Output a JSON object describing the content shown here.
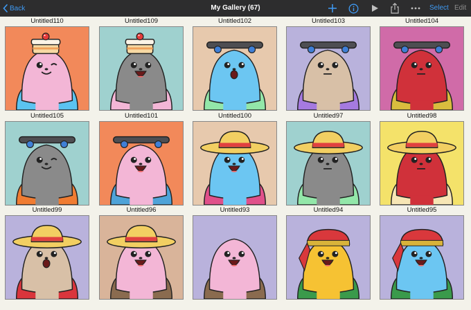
{
  "nav": {
    "back_label": "Back",
    "title": "My Gallery (67)",
    "select_label": "Select",
    "edit_label": "Edit",
    "accent": "#3f9bf5",
    "icons": [
      "plus-icon",
      "info-icon",
      "play-icon",
      "share-icon",
      "more-icon"
    ]
  },
  "gallery": {
    "items": [
      {
        "title": "Untitled110",
        "bg": "#f2895a",
        "body": "#f3b6d6",
        "shirt": "#5bc3f1",
        "hat": "cake",
        "face": "wink"
      },
      {
        "title": "Untitled109",
        "bg": "#9fd1cf",
        "body": "#8a8a8a",
        "shirt": "#f3b6d6",
        "hat": "cake",
        "face": "open"
      },
      {
        "title": "Untitled102",
        "bg": "#e7c9ad",
        "body": "#6cc6f2",
        "shirt": "#93e7a9",
        "hat": "skate",
        "face": "o"
      },
      {
        "title": "Untitled103",
        "bg": "#b9b2dc",
        "body": "#d8c0a7",
        "shirt": "#a57ae0",
        "hat": "skate",
        "face": "flat"
      },
      {
        "title": "Untitled104",
        "bg": "#d06ba8",
        "body": "#d0313a",
        "shirt": "#d9bd3e",
        "hat": "skate",
        "face": "flat"
      },
      {
        "title": "Untitled105",
        "bg": "#9fd1cf",
        "body": "#8a8a8a",
        "shirt": "#f07c32",
        "hat": "skate",
        "face": "wink"
      },
      {
        "title": "Untitled101",
        "bg": "#f2895a",
        "body": "#f3b6d6",
        "shirt": "#4fa3d8",
        "hat": "skate",
        "face": "open"
      },
      {
        "title": "Untitled100",
        "bg": "#e7c9ad",
        "body": "#6cc6f2",
        "shirt": "#e0508a",
        "hat": "straw",
        "face": "open"
      },
      {
        "title": "Untitled97",
        "bg": "#9fd1cf",
        "body": "#8a8a8a",
        "shirt": "#93e7a9",
        "hat": "straw",
        "face": "flat"
      },
      {
        "title": "Untitled98",
        "bg": "#f4e26a",
        "body": "#d0313a",
        "shirt": "#f7e6b5",
        "hat": "straw",
        "face": "flat"
      },
      {
        "title": "Untitled99",
        "bg": "#b9b2dc",
        "body": "#d8c0a7",
        "shirt": "#d9353c",
        "hat": "straw",
        "face": "o"
      },
      {
        "title": "Untitled96",
        "bg": "#d9b49a",
        "body": "#f3b6d6",
        "shirt": "#8a6b4f",
        "hat": "straw",
        "face": "open"
      },
      {
        "title": "Untitled93",
        "bg": "#b9b2dc",
        "body": "#f3b6d6",
        "shirt": "#8a6b4f",
        "hat": "none",
        "face": "open"
      },
      {
        "title": "Untitled94",
        "bg": "#b9b2dc",
        "body": "#f6c233",
        "shirt": "#3a9a4b",
        "hat": "bandana",
        "face": "open"
      },
      {
        "title": "Untitled95",
        "bg": "#b9b2dc",
        "body": "#6cc6f2",
        "shirt": "#3a9a4b",
        "hat": "bandana",
        "face": "open"
      }
    ]
  }
}
